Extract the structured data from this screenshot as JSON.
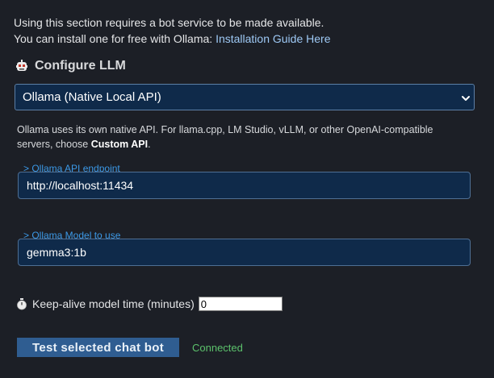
{
  "intro": {
    "line1": "Using this section requires a bot service to be made available.",
    "line2_prefix": "You can install one for free with Ollama: ",
    "guide_link": "Installation Guide Here"
  },
  "section": {
    "title": "Configure LLM",
    "icon": "robot-icon"
  },
  "provider_select": {
    "selected": "Ollama (Native Local API)"
  },
  "description": {
    "text": "Ollama uses its own native API. For llama.cpp, LM Studio, vLLM, or other OpenAI-compatible servers, choose ",
    "emphasis": "Custom API",
    "suffix": "."
  },
  "endpoint": {
    "label": "> Ollama API endpoint",
    "value": "http://localhost:11434"
  },
  "model": {
    "label": "> Ollama Model to use",
    "value": "gemma3:1b"
  },
  "keepalive": {
    "icon": "stopwatch-icon",
    "label": "Keep-alive model time (minutes)",
    "value": "0"
  },
  "test_button": {
    "label": "Test selected chat bot"
  },
  "status": {
    "text": "Connected",
    "color": "#5cc26c"
  },
  "colors": {
    "background": "#1c1f26",
    "accent": "#3b99e8",
    "field_bg": "#0f2a4a",
    "button_bg": "#2f5d91"
  }
}
